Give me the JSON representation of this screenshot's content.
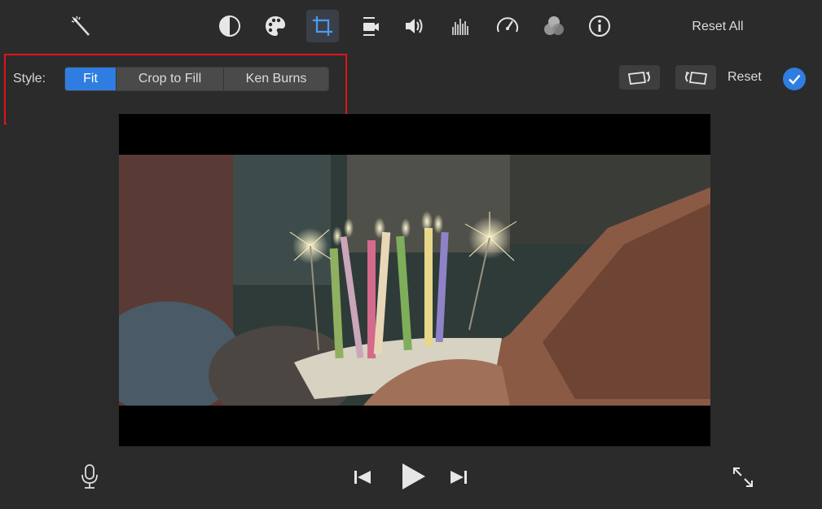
{
  "toolbar": {
    "tools": [
      {
        "name": "magic-wand-icon"
      },
      {
        "name": "color-balance-icon"
      },
      {
        "name": "color-palette-icon"
      },
      {
        "name": "crop-icon",
        "active": true
      },
      {
        "name": "stabilization-icon"
      },
      {
        "name": "volume-icon"
      },
      {
        "name": "equalizer-icon"
      },
      {
        "name": "speed-icon"
      },
      {
        "name": "filter-icon"
      },
      {
        "name": "info-icon"
      }
    ],
    "reset_all_label": "Reset All"
  },
  "style_row": {
    "label": "Style:",
    "options": [
      "Fit",
      "Crop to Fill",
      "Ken Burns"
    ],
    "selected": "Fit",
    "reset_label": "Reset"
  },
  "colors": {
    "accent": "#2f7de1",
    "highlight": "#e0141b",
    "background": "#2b2b2b"
  },
  "controls": {
    "icons": [
      "microphone-icon",
      "skip-back-icon",
      "play-icon",
      "skip-forward-icon",
      "fullscreen-icon"
    ]
  }
}
